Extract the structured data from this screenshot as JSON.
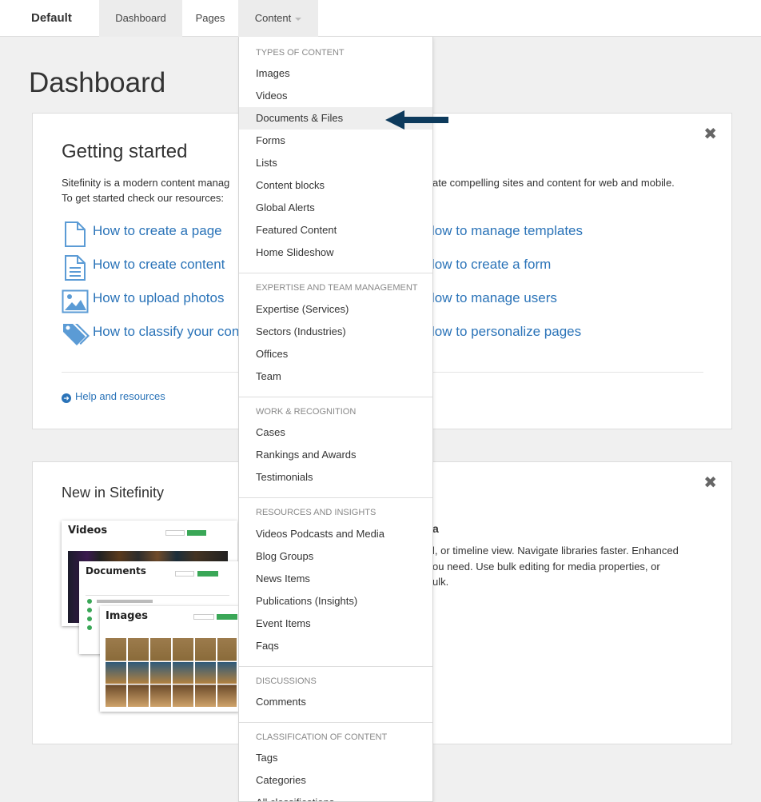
{
  "topbar": {
    "brand": "Default",
    "tabs": [
      {
        "label": "Dashboard"
      },
      {
        "label": "Pages"
      },
      {
        "label": "Content"
      }
    ]
  },
  "page_title": "Dashboard",
  "getting_started": {
    "title": "Getting started",
    "desc_left_1": "Sitefinity is a modern content manag",
    "desc_left_2": "To get started check our resources:",
    "desc_right": "ate compelling sites and content for web and mobile.",
    "links_left": [
      {
        "label": "How to create a page",
        "icon": "page-icon"
      },
      {
        "label": "How to create content",
        "icon": "document-icon"
      },
      {
        "label": "How to upload photos",
        "icon": "image-icon"
      },
      {
        "label": "How to classify your cont",
        "icon": "tags-icon"
      }
    ],
    "links_right": [
      {
        "label": "low to manage templates"
      },
      {
        "label": "low to create a form"
      },
      {
        "label": "low to manage users"
      },
      {
        "label": "low to personalize pages"
      }
    ],
    "help_label": "Help and resources",
    "close": "✖"
  },
  "new_in": {
    "title": "New in Sitefinity",
    "side_head": "a",
    "side_lines": [
      "l, or timeline view. Navigate libraries faster. Enhanced",
      "ou need. Use bulk editing for media properties, or",
      "ulk."
    ],
    "shots": {
      "videos": "Videos",
      "documents": "Documents",
      "images": "Images"
    },
    "close": "✖"
  },
  "dropdown": {
    "sections": [
      {
        "header": "Types of content",
        "items": [
          "Images",
          "Videos",
          "Documents & Files",
          "Forms",
          "Lists",
          "Content blocks",
          "Global Alerts",
          "Featured Content",
          "Home Slideshow"
        ]
      },
      {
        "header": "Expertise and team management",
        "items": [
          "Expertise (Services)",
          "Sectors (Industries)",
          "Offices",
          "Team"
        ]
      },
      {
        "header": "Work & recognition",
        "items": [
          "Cases",
          "Rankings and Awards",
          "Testimonials"
        ]
      },
      {
        "header": "Resources and insights",
        "items": [
          "Videos Podcasts and Media",
          "Blog Groups",
          "News Items",
          "Publications (Insights)",
          "Event Items",
          "Faqs"
        ]
      },
      {
        "header": "Discussions",
        "items": [
          "Comments"
        ]
      },
      {
        "header": "Classification of content",
        "items": [
          "Tags",
          "Categories",
          "All classifications"
        ]
      }
    ],
    "highlighted_item": "Documents & Files"
  },
  "colors": {
    "link": "#2a73b8",
    "arrow": "#0d3a5c",
    "highlight": "#eeeeee"
  }
}
